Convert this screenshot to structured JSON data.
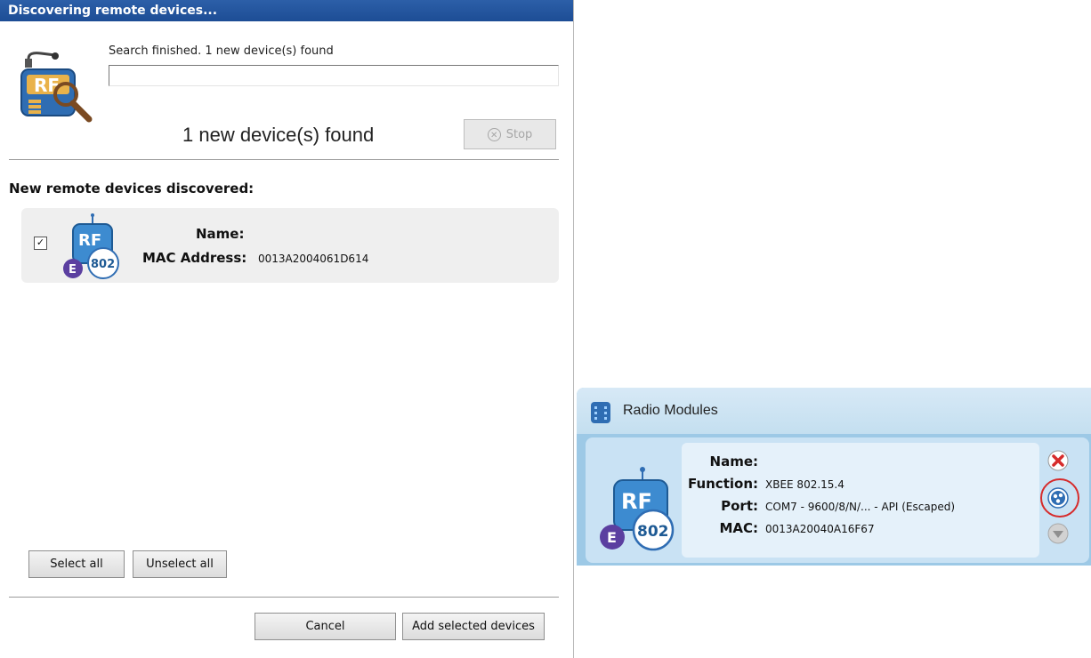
{
  "dialog": {
    "title": "Discovering remote devices...",
    "status_text": "Search finished. 1 new device(s) found",
    "progress": 0,
    "found_text": "1 new device(s) found",
    "stop_label": "Stop",
    "section_heading": "New remote devices discovered:",
    "device": {
      "checked": true,
      "checkmark": "✓",
      "name_label": "Name:",
      "mac_label": "MAC Address:",
      "mac_value": "0013A2004061D614",
      "icon_rf_text": "RF",
      "badge_letter": "E",
      "badge_number": "802"
    },
    "select_all_label": "Select all",
    "unselect_all_label": "Unselect all",
    "cancel_label": "Cancel",
    "add_selected_label": "Add selected devices",
    "main_icon_text": "RF"
  },
  "radio_panel": {
    "title": "Radio Modules",
    "module": {
      "name_label": "Name:",
      "function_label": "Function:",
      "function_value": "XBEE 802.15.4",
      "port_label": "Port:",
      "port_value": "COM7 - 9600/8/N/... - API (Escaped)",
      "mac_label": "MAC:",
      "mac_value": "0013A20040A16F67",
      "icon_rf_text": "RF",
      "badge_letter": "E",
      "badge_number": "802"
    }
  },
  "colors": {
    "title_bar": "#1d4d95",
    "panel_blue": "#9dc9e6",
    "badge_purple": "#5b3fa0",
    "close_red": "#d62b2b"
  },
  "icons": {
    "stop": "stop-icon",
    "close": "close-icon",
    "discover": "discover-remote-icon",
    "expand": "chevron-down-icon"
  }
}
